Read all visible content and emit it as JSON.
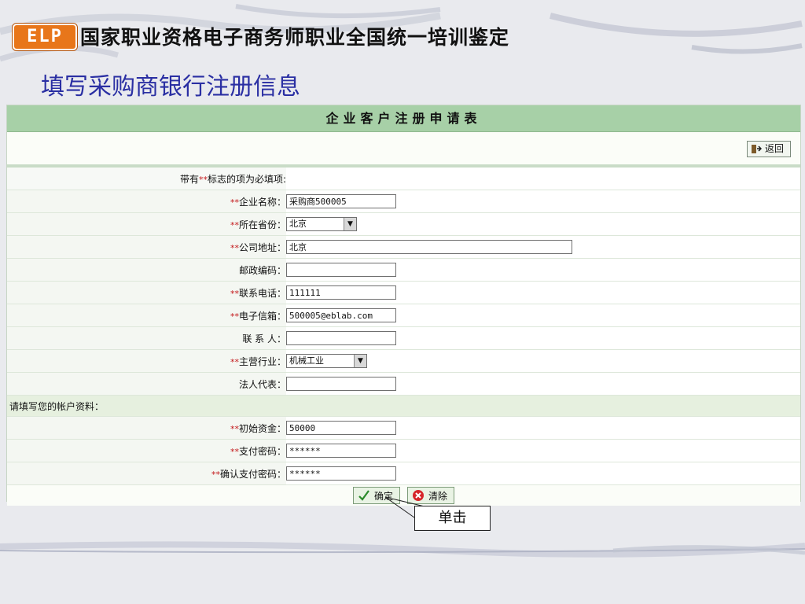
{
  "header": {
    "logo_text": "ELP",
    "title": "国家职业资格电子商务师职业全国统一培训鉴定"
  },
  "slide_title": "填写采购商银行注册信息",
  "form": {
    "heading": "企业客户注册申请表",
    "back_label": "返回",
    "required_note_prefix": "带有",
    "required_mark": "**",
    "required_note_suffix": "标志的项为必填项:",
    "fields": [
      {
        "label": "企业名称：",
        "required": true,
        "type": "text",
        "value": "采购商500005",
        "width": "short"
      },
      {
        "label": "所在省份：",
        "required": true,
        "type": "select",
        "value": "北京"
      },
      {
        "label": "公司地址：",
        "required": true,
        "type": "text",
        "value": "北京",
        "width": "long"
      },
      {
        "label": "邮政编码：",
        "required": false,
        "type": "text",
        "value": "",
        "width": "short"
      },
      {
        "label": "联系电话：",
        "required": true,
        "type": "text",
        "value": "111111",
        "width": "short"
      },
      {
        "label": "电子信箱：",
        "required": true,
        "type": "text",
        "value": "500005@eblab.com",
        "width": "short"
      },
      {
        "label": "联 系 人：",
        "required": false,
        "type": "text",
        "value": "",
        "width": "short"
      },
      {
        "label": "主营行业：",
        "required": true,
        "type": "select",
        "value": "机械工业"
      },
      {
        "label": "法人代表：",
        "required": false,
        "type": "text",
        "value": "",
        "width": "short"
      }
    ],
    "account_section": "请填写您的帐户资料：",
    "account_fields": [
      {
        "label": "初始资金：",
        "required": true,
        "value": "50000"
      },
      {
        "label": "支付密码：",
        "required": true,
        "value": "******"
      },
      {
        "label": "确认支付密码：",
        "required": true,
        "value": "******"
      }
    ],
    "confirm_label": "确定",
    "clear_label": "清除"
  },
  "callout_text": "单击",
  "colors": {
    "title_blue": "#2a2fa3",
    "header_green": "#a7d0a7",
    "required_red": "#c3181b"
  }
}
